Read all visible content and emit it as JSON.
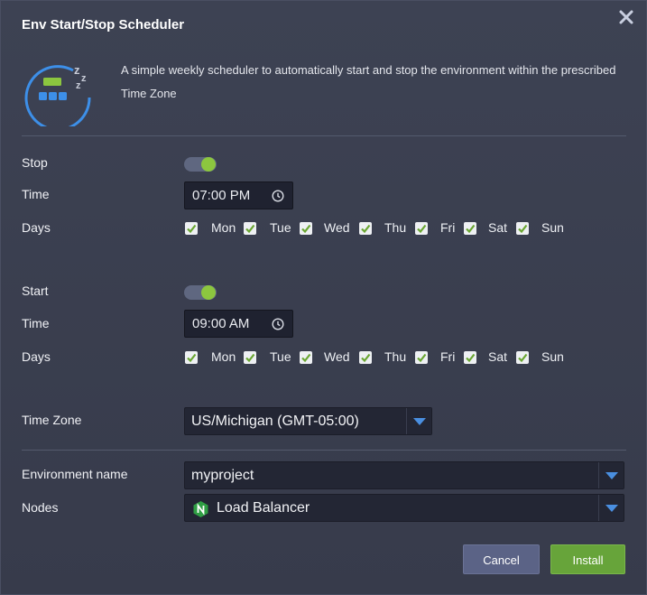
{
  "dialog": {
    "title": "Env Start/Stop Scheduler",
    "description": "A simple weekly scheduler to automatically start and stop the environment within the prescribed Time Zone"
  },
  "stop": {
    "label": "Stop",
    "enabled": true,
    "time_label": "Time",
    "time_value": "07:00 PM",
    "days_label": "Days",
    "days": [
      {
        "label": "Mon",
        "checked": true
      },
      {
        "label": "Tue",
        "checked": true
      },
      {
        "label": "Wed",
        "checked": true
      },
      {
        "label": "Thu",
        "checked": true
      },
      {
        "label": "Fri",
        "checked": true
      },
      {
        "label": "Sat",
        "checked": true
      },
      {
        "label": "Sun",
        "checked": true
      }
    ]
  },
  "start": {
    "label": "Start",
    "enabled": true,
    "time_label": "Time",
    "time_value": "09:00 AM",
    "days_label": "Days",
    "days": [
      {
        "label": "Mon",
        "checked": true
      },
      {
        "label": "Tue",
        "checked": true
      },
      {
        "label": "Wed",
        "checked": true
      },
      {
        "label": "Thu",
        "checked": true
      },
      {
        "label": "Fri",
        "checked": true
      },
      {
        "label": "Sat",
        "checked": true
      },
      {
        "label": "Sun",
        "checked": true
      }
    ]
  },
  "timezone": {
    "label": "Time Zone",
    "value": "US/Michigan (GMT-05:00)"
  },
  "environment": {
    "label": "Environment name",
    "value": "myproject"
  },
  "nodes": {
    "label": "Nodes",
    "value": "Load Balancer",
    "icon": "nginx-icon"
  },
  "buttons": {
    "cancel": "Cancel",
    "install": "Install"
  },
  "colors": {
    "accent_green": "#8cc63f",
    "install_button": "#67a43a",
    "cancel_button": "#5b6386",
    "dropdown_arrow": "#4a8fe0",
    "logo_ring": "#3d8fe8"
  }
}
